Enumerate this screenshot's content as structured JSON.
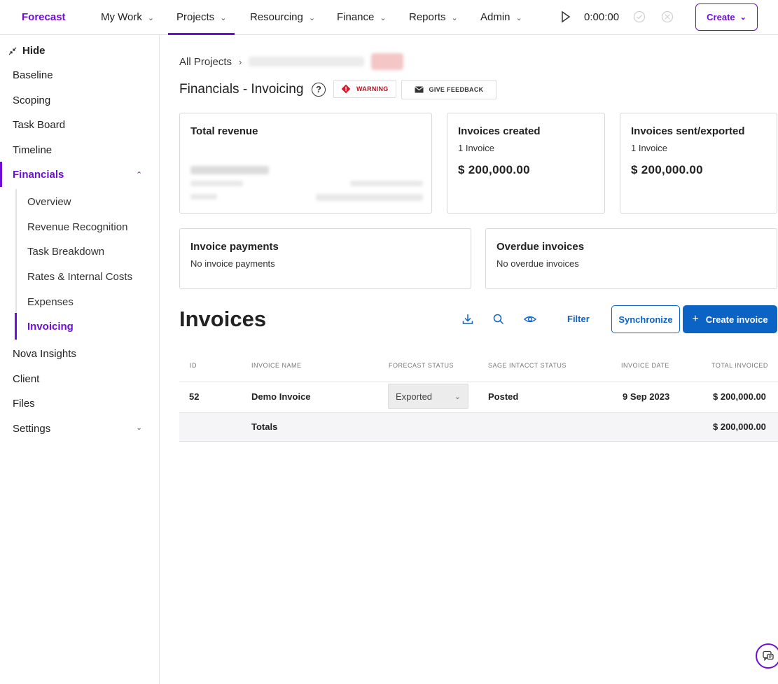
{
  "topnav": {
    "logo": "Forecast",
    "items": [
      {
        "label": "My Work"
      },
      {
        "label": "Projects"
      },
      {
        "label": "Resourcing"
      },
      {
        "label": "Finance"
      },
      {
        "label": "Reports"
      },
      {
        "label": "Admin"
      }
    ],
    "timer": "0:00:00",
    "create_label": "Create"
  },
  "sidebar": {
    "hide_label": "Hide",
    "items": [
      "Baseline",
      "Scoping",
      "Task Board",
      "Timeline",
      "Financials",
      "Nova Insights",
      "Client",
      "Files",
      "Settings"
    ],
    "financials_sub": [
      "Overview",
      "Revenue Recognition",
      "Task Breakdown",
      "Rates & Internal Costs",
      "Expenses",
      "Invoicing"
    ],
    "active_item": "Financials",
    "active_sub": "Invoicing"
  },
  "breadcrumb": {
    "root": "All Projects"
  },
  "page": {
    "title": "Financials - Invoicing",
    "warning_label": "WARNING",
    "feedback_label": "GIVE FEEDBACK"
  },
  "cards": {
    "total_revenue": {
      "title": "Total revenue"
    },
    "invoices_created": {
      "title": "Invoices created",
      "sub": "1 Invoice",
      "amount": "$ 200,000.00"
    },
    "invoices_sent": {
      "title": "Invoices sent/exported",
      "sub": "1 Invoice",
      "amount": "$ 200,000.00"
    },
    "invoice_payments": {
      "title": "Invoice payments",
      "sub": "No invoice payments"
    },
    "overdue_invoices": {
      "title": "Overdue invoices",
      "sub": "No overdue invoices"
    }
  },
  "invoices": {
    "title": "Invoices",
    "filter_label": "Filter",
    "sync_label": "Synchronize",
    "create_label": "Create invoice",
    "columns": [
      "ID",
      "INVOICE NAME",
      "FORECAST STATUS",
      "SAGE INTACCT STATUS",
      "INVOICE DATE",
      "TOTAL INVOICED"
    ],
    "rows": [
      {
        "id": "52",
        "name": "Demo Invoice",
        "forecast_status": "Exported",
        "sage_status": "Posted",
        "date": "9 Sep 2023",
        "total": "$ 200,000.00"
      }
    ],
    "totals": {
      "label": "Totals",
      "total": "$ 200,000.00"
    }
  },
  "colors": {
    "brand": "#6e0fd6",
    "primary": "#0b63c5",
    "warning": "#d7192b"
  }
}
